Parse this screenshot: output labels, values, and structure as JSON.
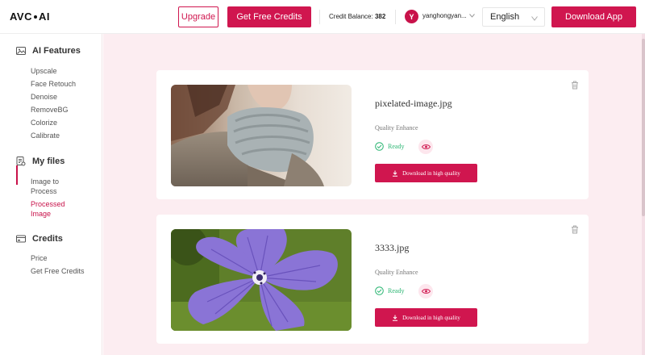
{
  "header": {
    "logo_left": "AVC",
    "logo_right": "AI",
    "upgrade_label": "Upgrade",
    "free_credits_label": "Get Free Credits",
    "balance_label": "Credit Balance:",
    "balance_value": "382",
    "avatar_initial": "Y",
    "username": "yanghongyan...",
    "language": "English",
    "download_app_label": "Download App"
  },
  "sidebar": {
    "sections": [
      {
        "title": "AI Features",
        "icon": "image-icon",
        "items": [
          "Upscale",
          "Face Retouch",
          "Denoise",
          "RemoveBG",
          "Colorize",
          "Calibrate"
        ]
      },
      {
        "title": "My files",
        "icon": "files-icon",
        "items": [
          "Image to Process",
          "Processed Image"
        ],
        "active_item": "Processed Image"
      },
      {
        "title": "Credits",
        "icon": "credits-icon",
        "items": [
          "Price",
          "Get Free Credits"
        ]
      }
    ]
  },
  "files": [
    {
      "name": "pixelated-image.jpg",
      "quality_label": "Quality Enhance",
      "status": "Ready",
      "download_label": "Download in high quality",
      "thumb": "person-scarf-photo"
    },
    {
      "name": "3333.jpg",
      "quality_label": "Quality Enhance",
      "status": "Ready",
      "download_label": "Download in high quality",
      "thumb": "purple-flower-photo"
    }
  ],
  "colors": {
    "accent": "#d0164f",
    "ready": "#2bb673",
    "main_bg": "#fcedf1"
  }
}
